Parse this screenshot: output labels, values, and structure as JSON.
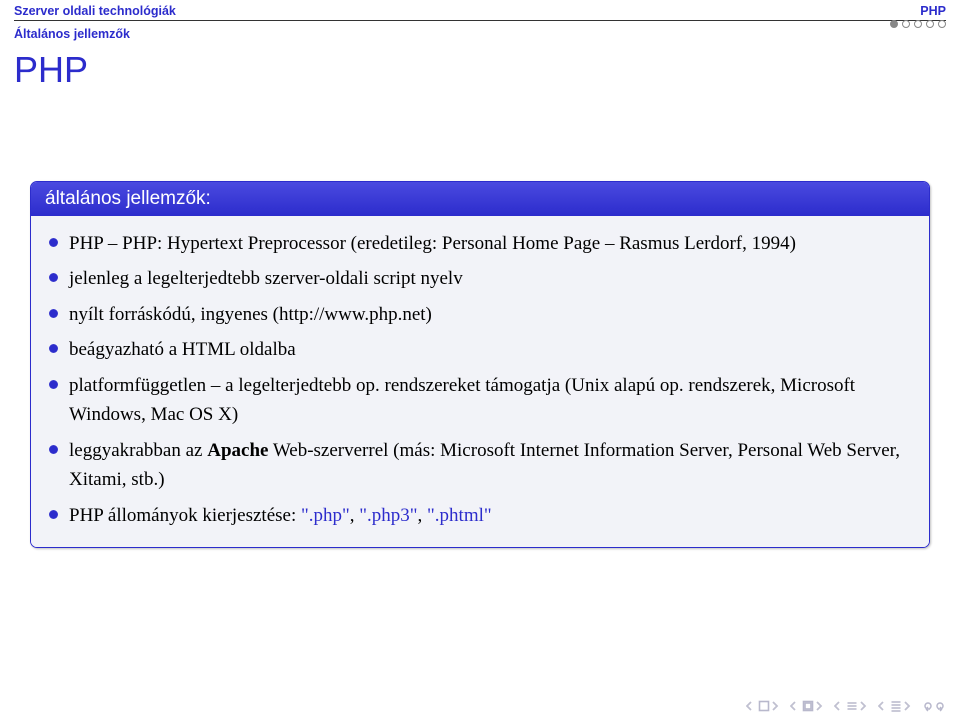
{
  "header": {
    "left": "Szerver oldali technológiák",
    "right": "PHP",
    "subsection": "Általános jellemzők"
  },
  "slide_title": "PHP",
  "block": {
    "title": "általános jellemzők:",
    "items": [
      {
        "html": "PHP – PHP: Hypertext Preprocessor (eredetileg: Personal Home Page – Rasmus Lerdorf, 1994)"
      },
      {
        "html": "jelenleg a legelterjedtebb szerver-oldali script nyelv"
      },
      {
        "html": "nyílt forráskódú, ingyenes (http://www.php.net)"
      },
      {
        "html": "beágyazható a HTML oldalba"
      },
      {
        "html": "platformfüggetlen – a legelterjedtebb op. rendszereket támogatja (Unix alapú op. rendszerek, Microsoft Windows, Mac OS X)"
      },
      {
        "html": "leggyakrabban az <span class=\"bold\">Apache</span> Web-szerverrel (más: Microsoft Internet Information Server, Personal Web Server, Xitami, stb.)"
      },
      {
        "html": "PHP állományok kierjesztése: <span class=\"ext\">\".php\"</span>, <span class=\"ext\">\".php3\"</span>, <span class=\"ext\">\".phtml\"</span>"
      }
    ]
  }
}
